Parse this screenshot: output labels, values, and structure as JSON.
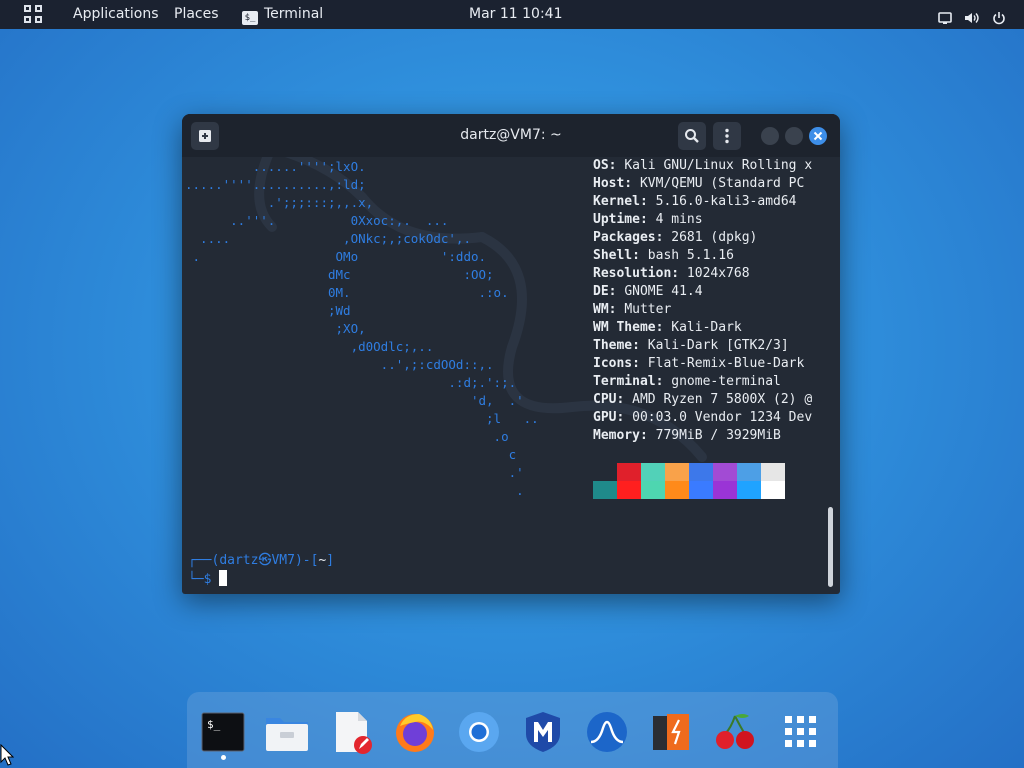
{
  "topbar": {
    "applications": "Applications",
    "places": "Places",
    "active_app": "Terminal",
    "active_app_icon_text": "$_",
    "clock": "Mar 11  10:41"
  },
  "terminal": {
    "title": "dartz@VM7: ~",
    "ascii_art": "         ......'''';lxO.\n.....''''..........,:ld;\n           .';;;:::;,,.x,\n      ..'''.          0Xxoc:,.  ...\n  ....               ,ONkc;,;cokOdc',.\n .                  OMo           ':ddo.\n                   dMc               :OO;\n                   0M.                 .:o.\n                   ;Wd\n                    ;XO,\n                      ,d0Odlc;,..\n                          ..',;:cdOOd::,.\n                                   .:d;.':;.\n                                      'd,  .'\n                                        ;l   ..\n                                         .o\n                                           c\n                                           .'\n                                            .",
    "info": [
      {
        "key": "OS:",
        "value": "Kali GNU/Linux Rolling x"
      },
      {
        "key": "Host:",
        "value": "KVM/QEMU (Standard PC"
      },
      {
        "key": "Kernel:",
        "value": "5.16.0-kali3-amd64"
      },
      {
        "key": "Uptime:",
        "value": "4 mins"
      },
      {
        "key": "Packages:",
        "value": "2681 (dpkg)"
      },
      {
        "key": "Shell:",
        "value": "bash 5.1.16"
      },
      {
        "key": "Resolution:",
        "value": "1024x768"
      },
      {
        "key": "DE:",
        "value": "GNOME 41.4"
      },
      {
        "key": "WM:",
        "value": "Mutter"
      },
      {
        "key": "WM Theme:",
        "value": "Kali-Dark"
      },
      {
        "key": "Theme:",
        "value": "Kali-Dark [GTK2/3]"
      },
      {
        "key": "Icons:",
        "value": "Flat-Remix-Blue-Dark"
      },
      {
        "key": "Terminal:",
        "value": "gnome-terminal"
      },
      {
        "key": "CPU:",
        "value": "AMD Ryzen 7 5800X (2) @"
      },
      {
        "key": "GPU:",
        "value": "00:03.0 Vendor 1234 Dev"
      },
      {
        "key": "Memory:",
        "value": "779MiB / 3929MiB"
      }
    ],
    "palette_top": [
      "#232a35",
      "#e0202b",
      "#52d1b8",
      "#f9a24a",
      "#3d78ea",
      "#a24bd4",
      "#4d9fe6",
      "#e6e6e6"
    ],
    "palette_bottom": [
      "#1f8a8a",
      "#ff1f1f",
      "#4ed6b0",
      "#ff8a1a",
      "#3a7bff",
      "#9a34d6",
      "#1fa3ff",
      "#ffffff"
    ],
    "prompt_line1_prefix": "┌──(",
    "prompt_user": "dartz㉿VM7",
    "prompt_mid": ")-[",
    "prompt_dir": "~",
    "prompt_end": "]",
    "prompt_line2_prefix": "└─",
    "prompt_symbol": "$"
  },
  "dock": {
    "items": [
      "terminal-icon",
      "files-icon",
      "text-editor-icon",
      "firefox-icon",
      "chromium-icon",
      "metasploit-icon",
      "wireshark-icon",
      "burpsuite-icon",
      "cherrytree-icon",
      "show-apps-icon"
    ]
  }
}
